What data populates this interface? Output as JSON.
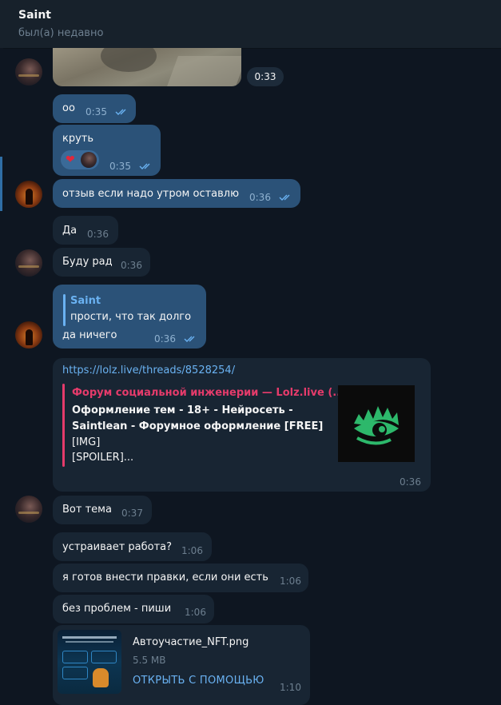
{
  "header": {
    "title": "Saint",
    "status": "был(а) недавно"
  },
  "photo": {
    "time": "0:33"
  },
  "messages": [
    {
      "text": "оо",
      "time": "0:35"
    },
    {
      "text": "круть",
      "time": "0:35",
      "reaction": "❤"
    },
    {
      "text": "отзыв если надо утром оставлю",
      "time": "0:36"
    },
    {
      "text": "Да",
      "time": "0:36"
    },
    {
      "text": "Буду рад",
      "time": "0:36"
    },
    {
      "reply_name": "Saint",
      "reply_text": "прости, что так долго",
      "text": "да ничего",
      "time": "0:36"
    },
    {
      "url": "https://lolz.live/threads/8528254/",
      "preview_site": "Форум социальной инженерии —  Lolz.live (...",
      "preview_lines": [
        "Оформление тем - 18+ - Нейросеть -",
        "Saintlean - Форумное оформление [FREE]",
        "[IMG]",
        "[SPOILER]..."
      ],
      "time": "0:36"
    },
    {
      "text": "Вот тема",
      "time": "0:37"
    },
    {
      "text": "устраивает работа?",
      "time": "1:06"
    },
    {
      "text": "я готов внести правки, если они есть",
      "time": "1:06"
    },
    {
      "text": "без проблем - пиши",
      "time": "1:06"
    },
    {
      "file_name": "Автоучастие_NFT.png",
      "file_size": "5.5 MB",
      "action": "ОТКРЫТЬ С ПОМОЩЬЮ",
      "time": "1:10"
    }
  ],
  "colors": {
    "background": "#0e1621",
    "outgoing": "#2b5278",
    "incoming": "#182533",
    "link": "#6ab2f2",
    "preview_accent": "#e53b6b",
    "logo_green": "#2db86b"
  }
}
